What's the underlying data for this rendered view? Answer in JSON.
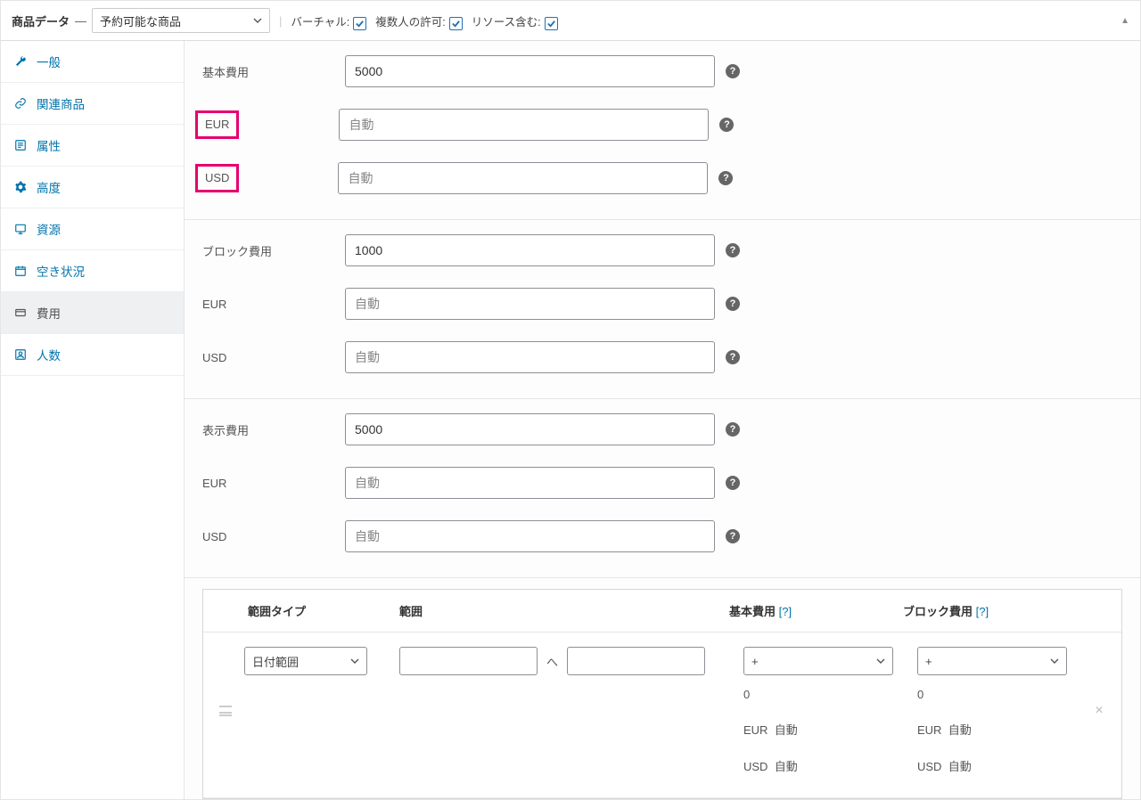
{
  "header": {
    "title": "商品データ",
    "product_type": "予約可能な商品",
    "virtual_label": "バーチャル:",
    "multi_label": "複数人の許可:",
    "resource_label": "リソース含む:",
    "virtual_checked": true,
    "multi_checked": true,
    "resource_checked": true
  },
  "tabs": {
    "general": "一般",
    "related": "関連商品",
    "attributes": "属性",
    "advanced": "高度",
    "resources": "資源",
    "availability": "空き状況",
    "cost": "費用",
    "persons": "人数"
  },
  "labels": {
    "base_cost": "基本費用",
    "block_cost": "ブロック費用",
    "display_cost": "表示費用",
    "eur": "EUR",
    "usd": "USD",
    "auto_placeholder": "自動"
  },
  "values": {
    "base_cost": "5000",
    "block_cost": "1000",
    "display_cost": "5000"
  },
  "range": {
    "head_type": "範囲タイプ",
    "head_range": "範囲",
    "head_base": "基本費用",
    "head_block": "ブロック費用",
    "qmark": "[?]",
    "type_value": "日付範囲",
    "tilde": "へ",
    "plus": "+",
    "zero": "0",
    "eur_auto": "自動",
    "usd_auto": "自動",
    "eur": "EUR",
    "usd": "USD"
  }
}
